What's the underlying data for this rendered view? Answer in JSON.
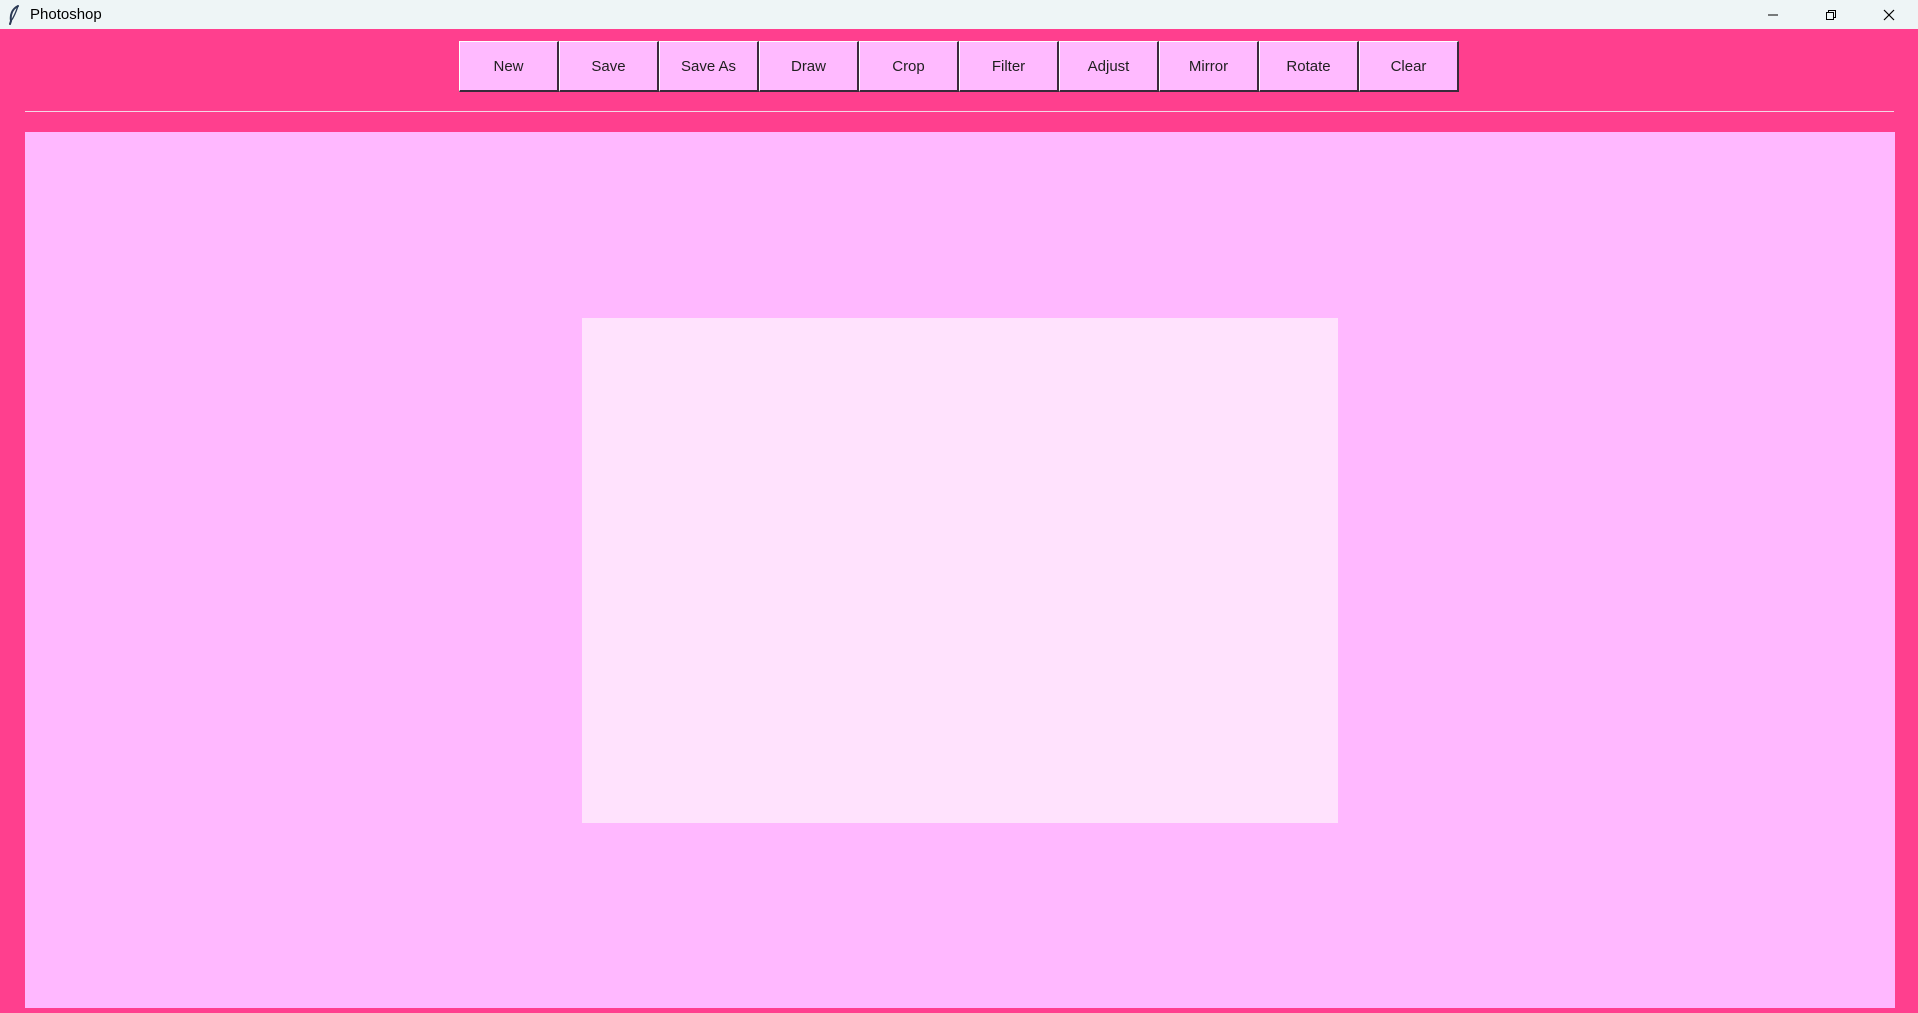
{
  "window": {
    "title": "Photoshop",
    "app_icon": "feather-icon",
    "controls": [
      "minimize-icon",
      "restore-icon",
      "close-icon"
    ]
  },
  "toolbar": {
    "buttons": [
      "New",
      "Save",
      "Save As",
      "Draw",
      "Crop",
      "Filter",
      "Adjust",
      "Mirror",
      "Rotate",
      "Clear"
    ]
  },
  "colors": {
    "window_background": "#ff3f8e",
    "workspace_background": "#ffb8ff",
    "canvas_background": "#ffe2fd",
    "button_background": "#ffbaff"
  }
}
